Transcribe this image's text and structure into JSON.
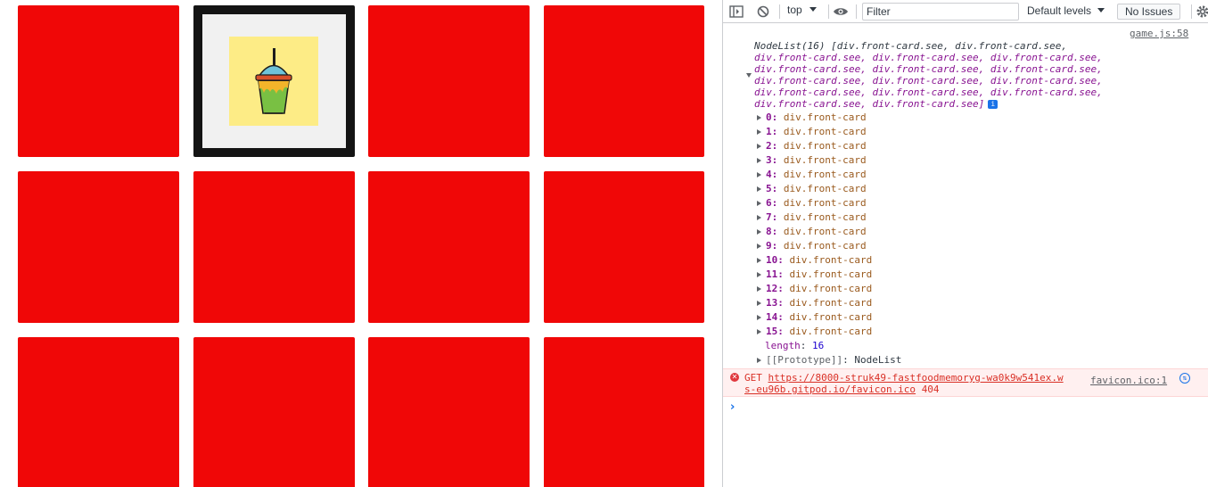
{
  "game": {
    "cards": [
      {
        "state": "hidden"
      },
      {
        "state": "flipped",
        "image": "fast-food-drink"
      },
      {
        "state": "hidden"
      },
      {
        "state": "hidden"
      },
      {
        "state": "hidden"
      },
      {
        "state": "hidden"
      },
      {
        "state": "hidden"
      },
      {
        "state": "hidden"
      },
      {
        "state": "hidden"
      },
      {
        "state": "hidden"
      },
      {
        "state": "hidden"
      },
      {
        "state": "hidden"
      }
    ],
    "colors": {
      "card_back": "#f00707",
      "card_border": "#141414",
      "card_face": "#f1f1f1",
      "image_bg": "#fdec86"
    }
  },
  "devtools": {
    "toolbar": {
      "context": "top",
      "filter_placeholder": "Filter",
      "levels": "Default levels",
      "issues": "No Issues"
    },
    "log": {
      "source": "game.js:58",
      "summary_lines": [
        "NodeList(16) [div.front-card.see, div.front-card.see,",
        "div.front-card.see, div.front-card.see, div.front-card.see,",
        "div.front-card.see, div.front-card.see, div.front-card.see,",
        "div.front-card.see, div.front-card.see, div.front-card.see,",
        "div.front-card.see, div.front-card.see, div.front-card.see,",
        "div.front-card.see, div.front-card.see]"
      ],
      "items": [
        {
          "index": "0:",
          "value": "div.front-card"
        },
        {
          "index": "1:",
          "value": "div.front-card"
        },
        {
          "index": "2:",
          "value": "div.front-card"
        },
        {
          "index": "3:",
          "value": "div.front-card"
        },
        {
          "index": "4:",
          "value": "div.front-card"
        },
        {
          "index": "5:",
          "value": "div.front-card"
        },
        {
          "index": "6:",
          "value": "div.front-card"
        },
        {
          "index": "7:",
          "value": "div.front-card"
        },
        {
          "index": "8:",
          "value": "div.front-card"
        },
        {
          "index": "9:",
          "value": "div.front-card"
        },
        {
          "index": "10:",
          "value": "div.front-card"
        },
        {
          "index": "11:",
          "value": "div.front-card"
        },
        {
          "index": "12:",
          "value": "div.front-card"
        },
        {
          "index": "13:",
          "value": "div.front-card"
        },
        {
          "index": "14:",
          "value": "div.front-card"
        },
        {
          "index": "15:",
          "value": "div.front-card"
        }
      ],
      "length_key": "length",
      "length_value": "16",
      "prototype_key": "[[Prototype]]",
      "prototype_value": "NodeList"
    },
    "error": {
      "method": "GET",
      "url_line1": "https://8000-struk49-fastfoodmemoryg-wa0k9w541ex.w",
      "url_line2": "s-eu96b.gitpod.io/favicon.ico",
      "status": "404",
      "source": "favicon.ico:1"
    },
    "prompt": "›"
  }
}
